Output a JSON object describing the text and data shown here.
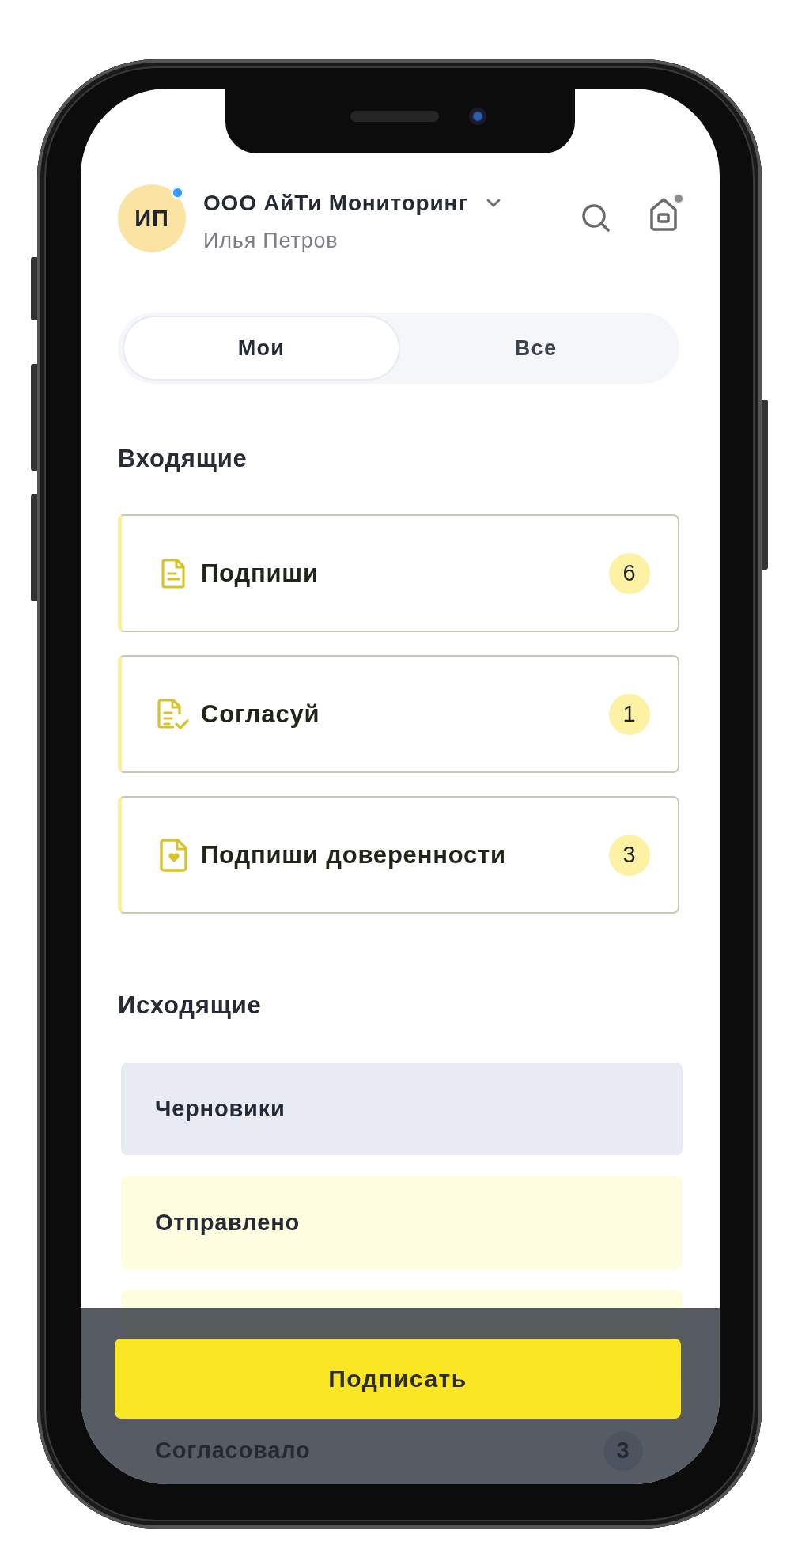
{
  "header": {
    "avatar": {
      "initials": "ИП",
      "online": true
    },
    "company": "ООО АйТи Мониторинг",
    "user": "Илья Петров",
    "home_notification": true
  },
  "tabs": [
    {
      "label": "Мои",
      "selected": true
    },
    {
      "label": "Все",
      "selected": false
    }
  ],
  "incoming": {
    "title": "Входящие",
    "items": [
      {
        "kind": "document",
        "label": "Подпиши",
        "count": "6"
      },
      {
        "kind": "document-check",
        "label": "Согласуй",
        "count": "1"
      },
      {
        "kind": "document-heart",
        "label": "Подпиши доверенности",
        "count": "3"
      }
    ]
  },
  "outgoing": {
    "title": "Исходящие",
    "items": [
      {
        "label": "Черновики",
        "color": "#e8ebf4"
      },
      {
        "label": "Отправлено",
        "color": "#fefde0"
      },
      {
        "color": "#fefde0"
      },
      {
        "label": "Согласовало",
        "count": "3"
      }
    ]
  },
  "action_button": "Подписать"
}
